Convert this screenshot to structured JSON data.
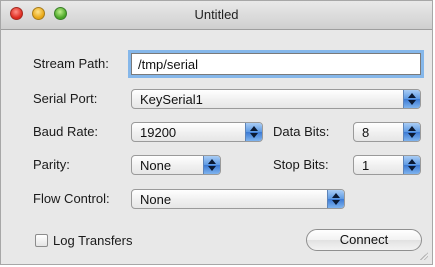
{
  "window": {
    "title": "Untitled"
  },
  "form": {
    "stream_path_label": "Stream Path:",
    "stream_path_value": "/tmp/serial",
    "serial_port_label": "Serial Port:",
    "serial_port_value": "KeySerial1",
    "baud_rate_label": "Baud Rate:",
    "baud_rate_value": "19200",
    "data_bits_label": "Data Bits:",
    "data_bits_value": "8",
    "parity_label": "Parity:",
    "parity_value": "None",
    "stop_bits_label": "Stop Bits:",
    "stop_bits_value": "1",
    "flow_control_label": "Flow Control:",
    "flow_control_value": "None",
    "log_transfers_label": "Log Transfers",
    "log_transfers_checked": false,
    "connect_label": "Connect"
  },
  "colors": {
    "focus_ring": "#85b7ea",
    "popup_arrow_blue": "#5d99e3"
  }
}
